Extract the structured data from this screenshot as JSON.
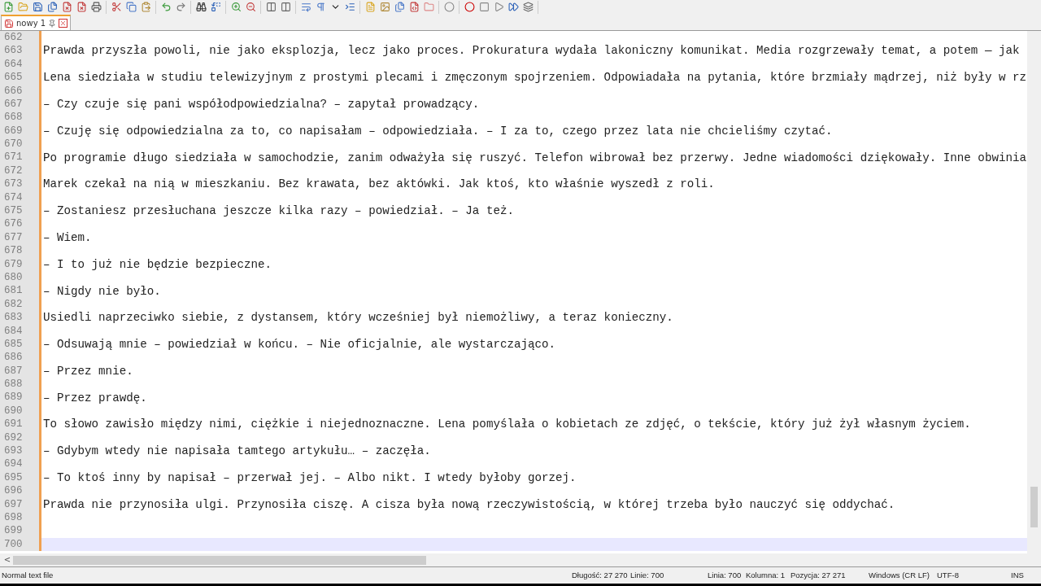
{
  "tabs": [
    {
      "label": "nowy 1",
      "selected": true,
      "modified": true
    }
  ],
  "editor": {
    "lines": [
      {
        "number": "662",
        "current": false
      },
      {
        "number": "663",
        "text": "Prawda przyszła powoli, nie jako eksplozja, lecz jako proces. Prokuratura wydała lakoniczny komunikat. Media rozgrzewały temat, a potem — jak",
        "current": false
      },
      {
        "number": "664",
        "current": false
      },
      {
        "number": "665",
        "text": "Lena siedziała w studiu telewizyjnym z prostymi plecami i zmęczonym spojrzeniem. Odpowiadała na pytania, które brzmiały mądrzej, niż były w rz",
        "current": false
      },
      {
        "number": "666",
        "current": false
      },
      {
        "number": "667",
        "text": "– Czy czuje się pani współodpowiedzialna? – zapytał prowadzący.",
        "current": false
      },
      {
        "number": "668",
        "current": false
      },
      {
        "number": "669",
        "text": "– Czuję się odpowiedzialna za to, co napisałam – odpowiedziała. – I za to, czego przez lata nie chcieliśmy czytać.",
        "current": false
      },
      {
        "number": "670",
        "current": false
      },
      {
        "number": "671",
        "text": "Po programie długo siedziała w samochodzie, zanim odważyła się ruszyć. Telefon wibrował bez przerwy. Jedne wiadomości dziękowały. Inne obwinia",
        "current": false
      },
      {
        "number": "672",
        "current": false
      },
      {
        "number": "673",
        "text": "Marek czekał na nią w mieszkaniu. Bez krawata, bez aktówki. Jak ktoś, kto właśnie wyszedł z roli.",
        "current": false
      },
      {
        "number": "674",
        "current": false
      },
      {
        "number": "675",
        "text": "– Zostaniesz przesłuchana jeszcze kilka razy – powiedział. – Ja też.",
        "current": false
      },
      {
        "number": "676",
        "current": false
      },
      {
        "number": "677",
        "text": "– Wiem.",
        "current": false
      },
      {
        "number": "678",
        "current": false
      },
      {
        "number": "679",
        "text": "– I to już nie będzie bezpieczne.",
        "current": false
      },
      {
        "number": "680",
        "current": false
      },
      {
        "number": "681",
        "text": "– Nigdy nie było.",
        "current": false
      },
      {
        "number": "682",
        "current": false
      },
      {
        "number": "683",
        "text": "Usiedli naprzeciwko siebie, z dystansem, który wcześniej był niemożliwy, a teraz konieczny.",
        "current": false
      },
      {
        "number": "684",
        "current": false
      },
      {
        "number": "685",
        "text": "– Odsuwają mnie – powiedział w końcu. – Nie oficjalnie, ale wystarczająco.",
        "current": false
      },
      {
        "number": "686",
        "current": false
      },
      {
        "number": "687",
        "text": "– Przez mnie.",
        "current": false
      },
      {
        "number": "688",
        "current": false
      },
      {
        "number": "689",
        "text": "– Przez prawdę.",
        "current": false
      },
      {
        "number": "690",
        "current": false
      },
      {
        "number": "691",
        "text": "To słowo zawisło między nimi, ciężkie i niejednoznaczne. Lena pomyślała o kobietach ze zdjęć, o tekście, który już żył własnym życiem.",
        "current": false
      },
      {
        "number": "692",
        "current": false
      },
      {
        "number": "693",
        "text": "– Gdybym wtedy nie napisała tamtego artykułu… – zaczęła.",
        "current": false
      },
      {
        "number": "694",
        "current": false
      },
      {
        "number": "695",
        "text": "– To ktoś inny by napisał – przerwał jej. – Albo nikt. I wtedy byłoby gorzej.",
        "current": false
      },
      {
        "number": "696",
        "current": false
      },
      {
        "number": "697",
        "text": "Prawda nie przynosiła ulgi. Przynosiła ciszę. A cisza była nową rzeczywistością, w której trzeba było nauczyć się oddychać.",
        "current": false
      },
      {
        "number": "698",
        "current": false
      },
      {
        "number": "699",
        "current": false
      },
      {
        "number": "700",
        "current": true
      }
    ]
  },
  "horizontal_scrollbar": {
    "arrow": "<"
  },
  "status_bar": {
    "file_type": "Normal text file",
    "length": "Długość: 27 270",
    "lines": "Linie: 700",
    "line": "Linia: 700",
    "column": "Kolumna: 1",
    "position": "Pozycja: 27 271",
    "eol": "Windows (CR LF)",
    "encoding": "UTF-8",
    "mode": "INS"
  }
}
